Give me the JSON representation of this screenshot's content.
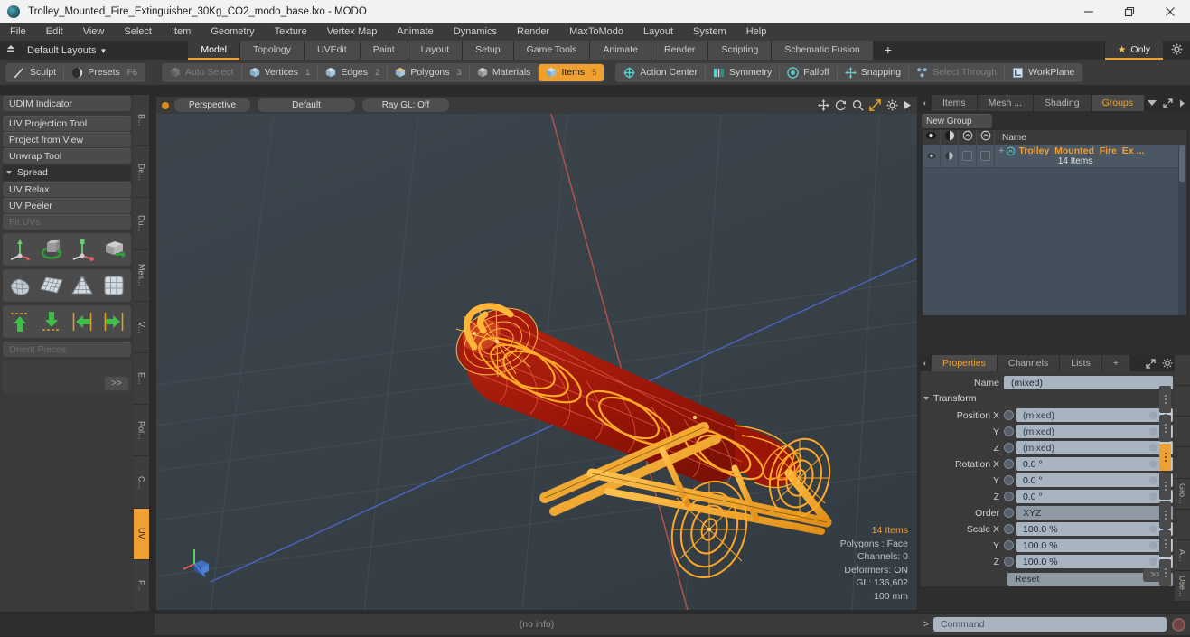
{
  "window": {
    "title": "Trolley_Mounted_Fire_Extinguisher_30Kg_CO2_modo_base.lxo - MODO",
    "logo_icon": "modo-logo-icon",
    "controls": [
      {
        "name": "minimize-button",
        "glyph": "minimize-icon"
      },
      {
        "name": "maximize-button",
        "glyph": "maximize-icon"
      },
      {
        "name": "close-button",
        "glyph": "close-icon"
      }
    ]
  },
  "menubar": {
    "items": [
      "File",
      "Edit",
      "View",
      "Select",
      "Item",
      "Geometry",
      "Texture",
      "Vertex Map",
      "Animate",
      "Dynamics",
      "Render",
      "MaxToModo",
      "Layout",
      "System",
      "Help"
    ]
  },
  "layoutbar": {
    "home_icon": "home-up-icon",
    "selector_label": "Default Layouts",
    "caret": "▼",
    "tabs": [
      {
        "label": "Model",
        "active": true
      },
      {
        "label": "Topology",
        "active": false
      },
      {
        "label": "UVEdit",
        "active": false
      },
      {
        "label": "Paint",
        "active": false
      },
      {
        "label": "Layout",
        "active": false
      },
      {
        "label": "Setup",
        "active": false
      },
      {
        "label": "Game Tools",
        "active": false
      },
      {
        "label": "Animate",
        "active": false
      },
      {
        "label": "Render",
        "active": false
      },
      {
        "label": "Scripting",
        "active": false
      },
      {
        "label": "Schematic Fusion",
        "active": false
      }
    ],
    "add_tab_label": "+",
    "only_label": "Only",
    "only_star": "★",
    "gear_icon": "gear-icon"
  },
  "toolbar": {
    "group_a": [
      {
        "label": "Sculpt",
        "icon": "brush-icon",
        "state": "normal",
        "badge": ""
      },
      {
        "label": "Presets",
        "icon": "sphere-icon",
        "state": "normal",
        "badge": "F6"
      }
    ],
    "group_b": [
      {
        "label": "Auto Select",
        "icon": "cube-gray-icon",
        "state": "dim",
        "badge": ""
      },
      {
        "label": "Vertices",
        "icon": "cube-blue-icon",
        "state": "normal",
        "badge": "1"
      },
      {
        "label": "Edges",
        "icon": "cube-blue-icon",
        "state": "normal",
        "badge": "2"
      },
      {
        "label": "Polygons",
        "icon": "cube-blue-icon",
        "state": "normal",
        "badge": "3"
      },
      {
        "label": "Materials",
        "icon": "cube-gray-icon",
        "state": "normal",
        "badge": ""
      },
      {
        "label": "Items",
        "icon": "cube-orange-icon",
        "state": "active",
        "badge": "5"
      },
      {
        "label": "Action Center",
        "icon": "crosshair-icon",
        "state": "normal",
        "badge": ""
      },
      {
        "label": "Symmetry",
        "icon": "mirror-icon",
        "state": "normal",
        "badge": ""
      },
      {
        "label": "Falloff",
        "icon": "falloff-icon",
        "state": "normal",
        "badge": ""
      },
      {
        "label": "Snapping",
        "icon": "snap-icon",
        "state": "normal",
        "badge": ""
      },
      {
        "label": "Select Through",
        "icon": "select-through-icon",
        "state": "dim",
        "badge": ""
      },
      {
        "label": "WorkPlane",
        "icon": "workplane-icon",
        "state": "normal",
        "badge": ""
      }
    ]
  },
  "left_panel": {
    "buttons_top": [
      {
        "label": "UDIM Indicator",
        "disabled": false
      }
    ],
    "buttons_mid": [
      {
        "label": "UV Projection Tool",
        "disabled": false
      },
      {
        "label": "Project from View",
        "disabled": false
      },
      {
        "label": "Unwrap Tool",
        "disabled": false
      }
    ],
    "section_header": "Spread",
    "buttons_low": [
      {
        "label": "UV Relax",
        "disabled": false
      },
      {
        "label": "UV Peeler",
        "disabled": false
      },
      {
        "label": "Fit UVs",
        "disabled": true
      }
    ],
    "icon_rows": [
      [
        "uv-move-axis-icon",
        "uv-rotate-icon",
        "uv-scale-axis-icon",
        "uv-flatten-icon"
      ],
      [
        "uv-shrink-icon",
        "uv-grid-plane-icon",
        "uv-cone-unwrap-icon",
        "uv-cube-grid-icon"
      ],
      [
        "align-up-icon",
        "align-down-icon",
        "align-left-icon",
        "align-right-icon"
      ]
    ],
    "orient_label": "Orient Pieces",
    "advanced_label": ">>",
    "vtabs": [
      {
        "label": "B...",
        "active": false
      },
      {
        "label": "De...",
        "active": false
      },
      {
        "label": "Du...",
        "active": false
      },
      {
        "label": "Mes...",
        "active": false
      },
      {
        "label": "V...",
        "active": false
      },
      {
        "label": "E...",
        "active": false
      },
      {
        "label": "Pol...",
        "active": false
      },
      {
        "label": "C...",
        "active": false
      },
      {
        "label": "UV",
        "active": true
      },
      {
        "label": "F...",
        "active": false
      }
    ]
  },
  "viewport": {
    "dot_icon": "viewport-menu-dot-icon",
    "mode_label": "Perspective",
    "shading_label": "Default",
    "raygl_label": "Ray GL: Off",
    "icons": [
      "pan-icon",
      "rotate-icon",
      "zoom-icon",
      "fit-view-icon",
      "viewport-settings-icon",
      "more-arrow-icon"
    ],
    "stats": {
      "items": "14 Items",
      "polygons": "Polygons : Face",
      "channels": "Channels: 0",
      "deformers": "Deformers: ON",
      "gl": "GL: 136,602",
      "grid": "100 mm"
    },
    "gizmo_name": "axis-gizmo"
  },
  "right_panel": {
    "top_tabs": [
      {
        "label": "Items",
        "active": false
      },
      {
        "label": "Mesh ...",
        "active": false
      },
      {
        "label": "Shading",
        "active": false
      },
      {
        "label": "Groups",
        "active": true
      }
    ],
    "top_tab_icons": [
      "dropdown-caret-icon",
      "expand-panel-icon",
      "panel-menu-arrow-icon"
    ],
    "new_group_label": "New Group",
    "group_columns": [
      "eye-icon",
      "render-icon",
      "lock-a-icon",
      "lock-b-icon"
    ],
    "group_name_header": "Name",
    "group_row": {
      "plus": "+",
      "item_icon": "group-item-icon",
      "name": "Trolley_Mounted_Fire_Ex ...",
      "count": "14 Items"
    },
    "properties": {
      "tabs": [
        {
          "label": "Properties",
          "active": true
        },
        {
          "label": "Channels",
          "active": false
        },
        {
          "label": "Lists",
          "active": false
        },
        {
          "label": "+",
          "active": false
        }
      ],
      "tab_icons": [
        "expand-panel-icon",
        "gear-icon",
        "panel-menu-arrow-icon"
      ],
      "name_label": "Name",
      "name_value": "(mixed)",
      "transform_header": "Transform",
      "rows": [
        {
          "label": "Position X",
          "value": "(mixed)",
          "type": "num"
        },
        {
          "label": "Y",
          "value": "(mixed)",
          "type": "num"
        },
        {
          "label": "Z",
          "value": "(mixed)",
          "type": "num"
        },
        {
          "label": "Rotation X",
          "value": "0.0 °",
          "type": "num"
        },
        {
          "label": "Y",
          "value": "0.0 °",
          "type": "num"
        },
        {
          "label": "Z",
          "value": "0.0 °",
          "type": "num"
        },
        {
          "label": "Order",
          "value": "XYZ",
          "type": "drop"
        },
        {
          "label": "Scale X",
          "value": "100.0 %",
          "type": "num"
        },
        {
          "label": "Y",
          "value": "100.0 %",
          "type": "num"
        },
        {
          "label": "Z",
          "value": "100.0 %",
          "type": "num"
        }
      ],
      "reset_label": "Reset",
      "advanced_label": ">>",
      "vtabs": [
        {
          "label": "",
          "active": false
        },
        {
          "label": "",
          "active": false
        },
        {
          "label": "",
          "active": true
        },
        {
          "label": "",
          "active": false
        },
        {
          "label": "Gro...",
          "active": false
        },
        {
          "label": "",
          "active": false
        },
        {
          "label": "A...",
          "active": false
        },
        {
          "label": "Use...",
          "active": false
        }
      ]
    }
  },
  "statusbar": {
    "info": "(no info)"
  },
  "command_bar": {
    "prompt": ">",
    "placeholder": "Command",
    "record_icon": "record-icon"
  },
  "colors": {
    "accent_orange": "#f0a030",
    "viewport_bg": "#39424a",
    "model_body": "#9e1a0a",
    "model_wire": "#ffa828",
    "panel_bg": "#3a3a3a",
    "field_bg": "#a8b5c0"
  }
}
